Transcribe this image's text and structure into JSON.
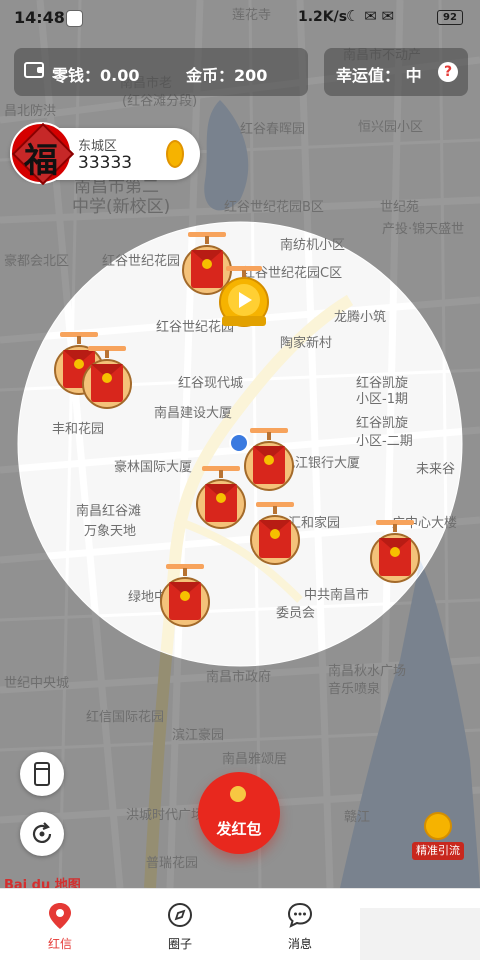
{
  "status": {
    "time": "14:48",
    "speed": "1.2K/s",
    "icons": "☾ ✉ ✉",
    "battery": "92"
  },
  "topbar": {
    "change_label": "零钱：0.00",
    "coin_label": "金币：200",
    "luck_label": "幸运值：  中",
    "help_icon": "?"
  },
  "user": {
    "avatar_char": "福",
    "district": "东城区",
    "score": "33333"
  },
  "map_labels": [
    "莲花寺",
    "南昌市不动产",
    "南昌市老",
    "(红谷滩分段)",
    "昌北防洪",
    "红谷春晖园",
    "恒兴园小区",
    "南昌市第二",
    "中学(新校区)",
    "红谷世纪花园B区",
    "世纪苑",
    "产投·锦天盛世",
    "豪都会北区",
    "红谷世纪花园",
    "南纺机小区",
    "红谷世纪花园C区",
    "红谷世纪花园",
    "龙腾小筑",
    "陶家新村",
    "红谷现代城",
    "红谷凯旋",
    "小区-1期",
    "南昌建设大厦",
    "丰和花园",
    "红谷凯旋",
    "小区-二期",
    "豪林国际大厦",
    "九江银行大厦",
    "未来谷",
    "南昌红谷滩",
    "万象天地",
    "汇和家园",
    "广中心大楼",
    "中共南昌市",
    "委员会",
    "绿地中央广场",
    "南昌市政府",
    "南昌秋水广场",
    "音乐喷泉",
    "世纪中央城",
    "红信国际花园",
    "滨江豪园",
    "南昌雅颂居",
    "洪城时代广场",
    "赣江",
    "普瑞花园"
  ],
  "center_button": {
    "label": "发红包"
  },
  "precise_button": {
    "label": "精准引流"
  },
  "baidu": "Bai du 地图",
  "nav": [
    {
      "label": "红信",
      "icon": "location-pin-icon",
      "active": true
    },
    {
      "label": "圈子",
      "icon": "compass-icon",
      "active": false
    },
    {
      "label": "消息",
      "icon": "chat-bubble-icon",
      "active": false
    }
  ],
  "colors": {
    "accent": "#e53935",
    "envelope": "#e8281e",
    "gold": "#f6b300",
    "user_dot": "#3a7ae0"
  }
}
